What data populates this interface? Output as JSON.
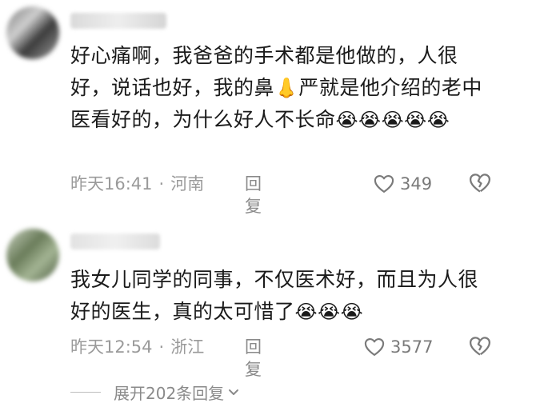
{
  "comments": [
    {
      "text_before_emoji": "好心痛啊，我爸爸的手术都是他做的，人很好，说话也好，我的鼻",
      "inline_emoji_icon": "nose-emoji",
      "inline_emoji_glyph": "👃",
      "text_after_emoji": "严就是他介绍的老中医看好的，为什么好人不长命",
      "trailing_emojis": "😭😭😭😭😭",
      "time": "昨天16:41",
      "separator": "·",
      "location": "河南",
      "reply_label": "回复",
      "like_count": "349"
    },
    {
      "text": "我女儿同学的同事，不仅医术好，而且为人很好的医生，真的太可惜了",
      "trailing_emojis": "😭😭😭",
      "time": "昨天12:54",
      "separator": "·",
      "location": "浙江",
      "reply_label": "回复",
      "like_count": "3577"
    }
  ],
  "expand_replies": {
    "label": "展开202条回复"
  },
  "colors": {
    "text_primary": "#1a1a1a",
    "text_meta": "#9a9a9a",
    "icon_gray": "#7a7a7a"
  },
  "icons": [
    "heart-outline-icon",
    "broken-heart-icon",
    "chevron-down-icon",
    "crying-face-emoji",
    "nose-emoji"
  ]
}
